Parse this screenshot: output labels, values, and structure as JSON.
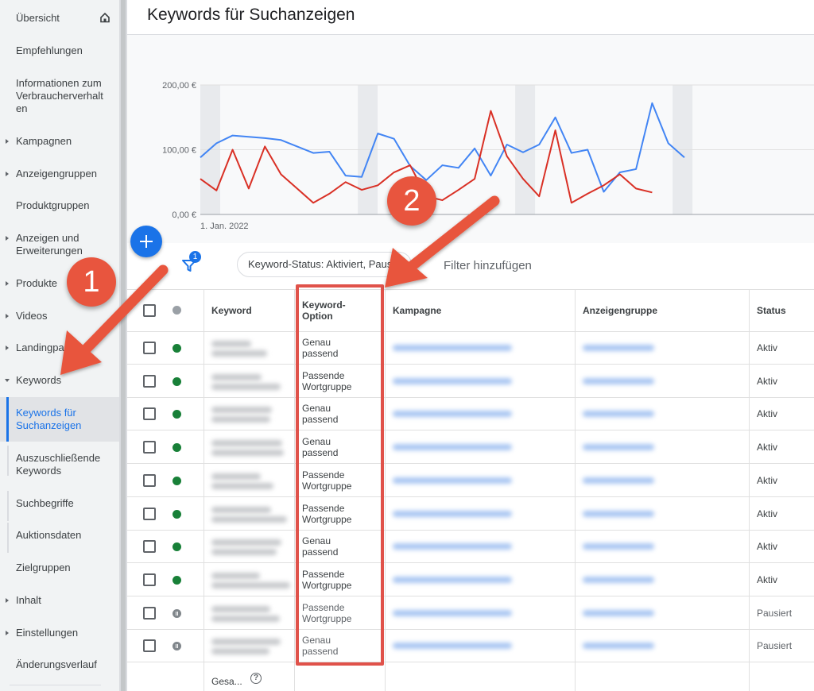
{
  "sidebar": {
    "items": [
      {
        "label": "Übersicht",
        "caret": "",
        "top": 0
      },
      {
        "label": "Empfehlungen",
        "caret": ""
      },
      {
        "label": "Informationen zum Verbraucherverhalt en",
        "caret": ""
      },
      {
        "label": "Kampagnen",
        "caret": "right"
      },
      {
        "label": "Anzeigengruppen",
        "caret": "right"
      },
      {
        "label": "Produktgruppen",
        "caret": ""
      },
      {
        "label": "Anzeigen und Erweiterungen",
        "caret": "right"
      },
      {
        "label": "Produkte",
        "caret": "right"
      },
      {
        "label": "Videos",
        "caret": "right"
      },
      {
        "label": "Landingpages",
        "caret": "right"
      },
      {
        "label": "Keywords",
        "caret": "down"
      },
      {
        "label": "Keywords für Suchanzeigen",
        "caret": "",
        "active": true
      },
      {
        "label": "Auszuschließende Keywords",
        "caret": ""
      },
      {
        "label": "Suchbegriffe",
        "caret": ""
      },
      {
        "label": "Auktionsdaten",
        "caret": ""
      },
      {
        "label": "Zielgruppen",
        "caret": ""
      },
      {
        "label": "Inhalt",
        "caret": "right"
      },
      {
        "label": "Einstellungen",
        "caret": "right"
      },
      {
        "label": "Änderungsverlauf",
        "caret": ""
      }
    ]
  },
  "header": {
    "title": "Keywords für Suchanzeigen"
  },
  "chart_data": {
    "type": "line",
    "yticks": [
      "200,00 €",
      "100,00 €",
      "0,00 €"
    ],
    "ylim": [
      0,
      200
    ],
    "xlabel_start": "1. Jan. 2022",
    "series": [
      {
        "color": "#4285f4",
        "values": [
          88,
          110,
          122,
          120,
          118,
          115,
          105,
          95,
          97,
          60,
          58,
          125,
          117,
          75,
          53,
          76,
          72,
          102,
          60,
          108,
          96,
          108,
          150,
          95,
          100,
          35,
          65,
          70,
          172,
          110,
          88
        ]
      },
      {
        "color": "#d93025",
        "values": [
          55,
          37,
          100,
          40,
          105,
          62,
          40,
          18,
          32,
          50,
          38,
          45,
          65,
          76,
          28,
          22,
          38,
          55,
          160,
          90,
          55,
          28,
          130,
          18,
          32,
          45,
          62,
          40,
          34
        ]
      }
    ],
    "colors": {
      "blue": "#4285f4",
      "red": "#d93025"
    }
  },
  "toolbar": {
    "filter_count": "1",
    "filter_chip": "Keyword-Status: Aktiviert, Pausiert",
    "add_filter": "Filter hinzufügen"
  },
  "table": {
    "headers": {
      "keyword": "Keyword",
      "match_type": "Keyword-Option",
      "campaign": "Kampagne",
      "ad_group": "Anzeigengruppe",
      "status": "Status"
    },
    "rows": [
      {
        "match_type": "Genau passend",
        "status": "Aktiv",
        "paused": false
      },
      {
        "match_type": "Passende Wortgruppe",
        "status": "Aktiv",
        "paused": false
      },
      {
        "match_type": "Genau passend",
        "status": "Aktiv",
        "paused": false
      },
      {
        "match_type": "Genau passend",
        "status": "Aktiv",
        "paused": false
      },
      {
        "match_type": "Passende Wortgruppe",
        "status": "Aktiv",
        "paused": false
      },
      {
        "match_type": "Passende Wortgruppe",
        "status": "Aktiv",
        "paused": false
      },
      {
        "match_type": "Genau passend",
        "status": "Aktiv",
        "paused": false
      },
      {
        "match_type": "Passende Wortgruppe",
        "status": "Aktiv",
        "paused": false
      },
      {
        "match_type": "Passende Wortgruppe",
        "status": "Pausiert",
        "paused": true
      },
      {
        "match_type": "Genau passend",
        "status": "Pausiert",
        "paused": true
      }
    ],
    "total_label": "Gesa...",
    "help_glyph": "?"
  },
  "annotations": {
    "callout_1": "1",
    "callout_2": "2",
    "color": "#e8553e"
  }
}
